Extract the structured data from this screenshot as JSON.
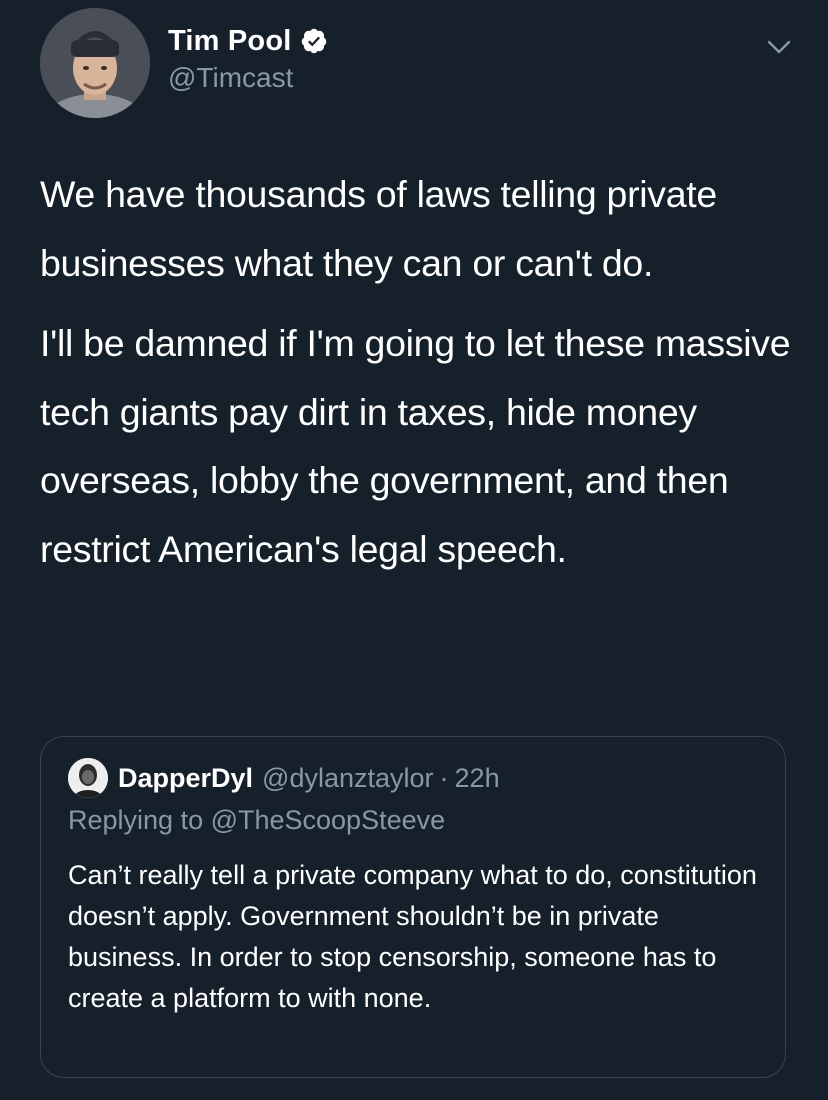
{
  "tweet": {
    "author_name": "Tim Pool",
    "author_handle": "@Timcast",
    "paragraphs": [
      "We have thousands of laws telling private businesses what they can or can't do.",
      "I'll be damned if I'm going to let these massive tech giants pay dirt in taxes, hide money overseas, lobby the government, and then restrict American's legal speech."
    ]
  },
  "quoted_tweet": {
    "author_name": "DapperDyl",
    "author_handle": "@dylanztaylor",
    "timestamp": "22h",
    "separator": "·",
    "replying_to": "Replying to @TheScoopSteeve",
    "text": "Can’t really tell a private company what to do, constitution doesn’t apply. Government shouldn’t be in private business. In order to stop censorship, someone has to create a platform to with none."
  },
  "icons": {
    "verified": "verified-badge-icon",
    "menu": "chevron-down-icon"
  },
  "colors": {
    "background": "#15202b",
    "text_primary": "#ffffff",
    "text_secondary": "#8899a6",
    "border": "#38444d"
  }
}
